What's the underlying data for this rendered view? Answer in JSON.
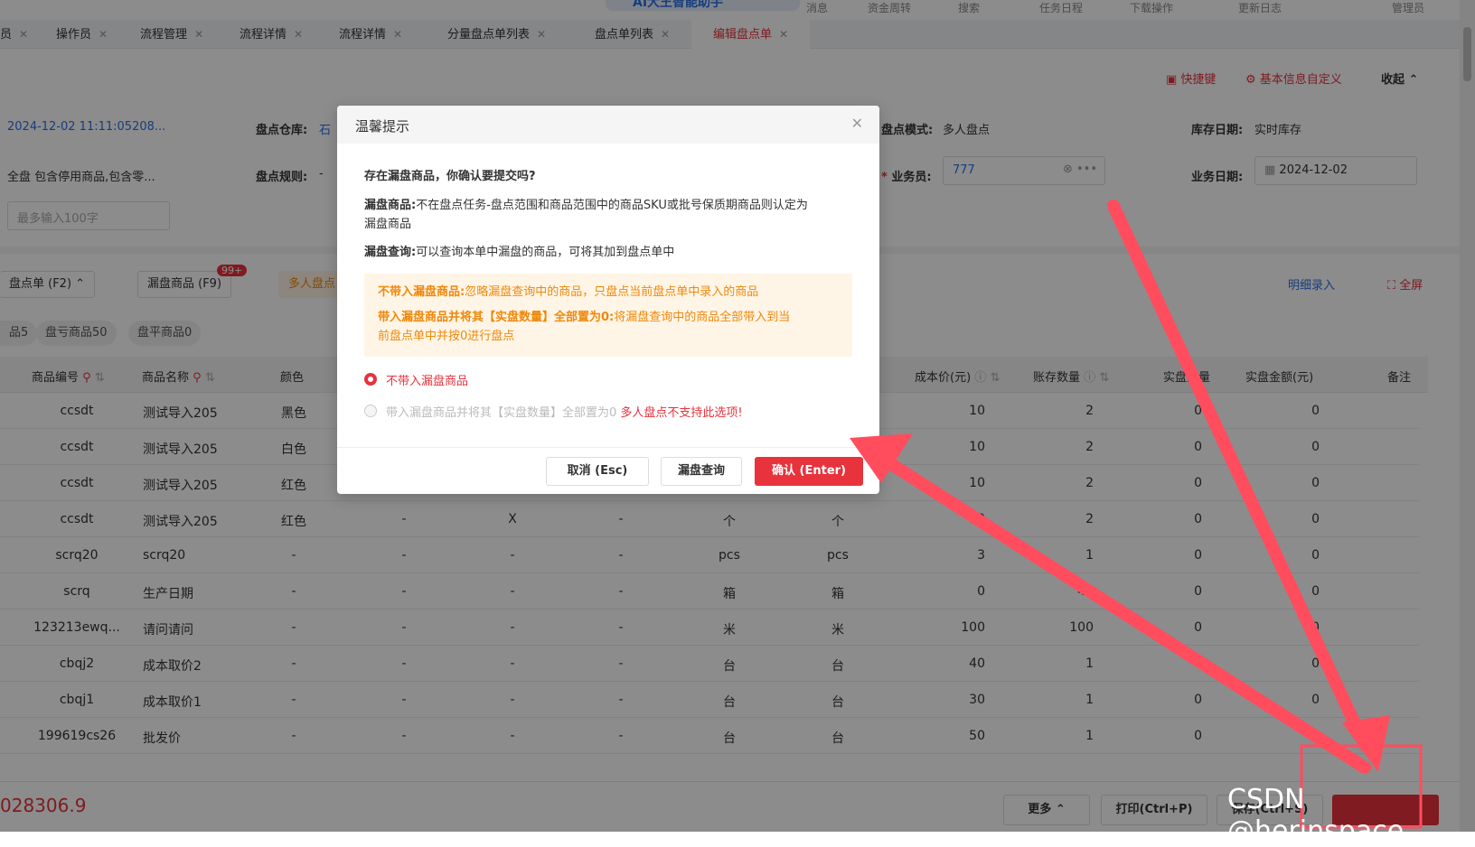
{
  "topbar": {
    "ai_label": "AI大王智能助手",
    "items": [
      "消息",
      "资金周转",
      "搜索",
      "任务日程",
      "下载操作",
      "更新日志",
      "管理员"
    ]
  },
  "tabs": [
    {
      "label": "员"
    },
    {
      "label": "操作员"
    },
    {
      "label": "流程管理"
    },
    {
      "label": "流程详情"
    },
    {
      "label": "流程详情"
    },
    {
      "label": "分量盘点单列表"
    },
    {
      "label": "盘点单列表"
    },
    {
      "label": "编辑盘点单"
    }
  ],
  "toolbar": {
    "shortcut": "快捷键",
    "custom": "基本信息自定义",
    "collapse": "收起"
  },
  "form": {
    "order_no": "2024-12-02 11:11:05208...",
    "warehouse_label": "盘点仓库:",
    "warehouse_value": "石",
    "mode_label": "盘点模式:",
    "mode_value": "多人盘点",
    "stock_date_label": "库存日期:",
    "stock_date_value": "实时库存",
    "scope_value": "全盘 包含停用商品,包含零...",
    "rule_label": "盘点规则:",
    "rule_value": "-",
    "salesman_label": "业务员:",
    "salesman_value": "777",
    "biz_date_label": "业务日期:",
    "biz_date_value": "2024-12-02",
    "remark_placeholder": "最多输入100字"
  },
  "actions": {
    "collapse_order": "盘点单 (F2)",
    "missed_goods": "漏盘商品 (F9)",
    "missed_badge": "99+",
    "multi": "多人盘点",
    "detail_entry": "明细录入",
    "fullscreen": "全屏"
  },
  "filters": [
    "品5",
    "盘亏商品50",
    "盘平商品0"
  ],
  "table": {
    "headers": [
      "商品编号",
      "商品名称",
      "颜色",
      "成本价(元)",
      "账存数量",
      "实盘数量",
      "实盘金额(元)",
      "备注"
    ],
    "rows": [
      {
        "code": "ccsdt",
        "name": "测试导入205",
        "color": "黑色",
        "cost": "10",
        "book": "2",
        "actual": "0",
        "amount": "0"
      },
      {
        "code": "ccsdt",
        "name": "测试导入205",
        "color": "白色",
        "cost": "10",
        "book": "2",
        "actual": "0",
        "amount": "0"
      },
      {
        "code": "ccsdt",
        "name": "测试导入205",
        "color": "红色",
        "cost": "10",
        "book": "2",
        "actual": "0",
        "amount": "0"
      },
      {
        "code": "ccsdt",
        "name": "测试导入205",
        "color": "红色",
        "c4": "-",
        "c5": "X",
        "c6": "-",
        "u1": "个",
        "u2": "个",
        "cost": "10",
        "book": "2",
        "actual": "0",
        "amount": "0"
      },
      {
        "code": "scrq20",
        "name": "scrq20",
        "color": "-",
        "c4": "-",
        "c5": "-",
        "c6": "-",
        "u1": "pcs",
        "u2": "pcs",
        "cost": "3",
        "book": "1",
        "actual": "0",
        "amount": "0"
      },
      {
        "code": "scrq",
        "name": "生产日期",
        "color": "-",
        "c4": "-",
        "c5": "-",
        "c6": "-",
        "u1": "箱",
        "u2": "箱",
        "cost": "0",
        "book": "40",
        "actual": "0",
        "amount": "0"
      },
      {
        "code": "123213ewq...",
        "name": "请问请问",
        "color": "-",
        "c4": "-",
        "c5": "-",
        "c6": "-",
        "u1": "米",
        "u2": "米",
        "cost": "100",
        "book": "100",
        "actual": "0",
        "amount": "0"
      },
      {
        "code": "cbqj2",
        "name": "成本取价2",
        "color": "-",
        "c4": "-",
        "c5": "-",
        "c6": "-",
        "u1": "台",
        "u2": "台",
        "cost": "40",
        "book": "1",
        "actual": "0",
        "amount": "0"
      },
      {
        "code": "cbqj1",
        "name": "成本取价1",
        "color": "-",
        "c4": "-",
        "c5": "-",
        "c6": "-",
        "u1": "台",
        "u2": "台",
        "cost": "30",
        "book": "1",
        "actual": "0",
        "amount": "0"
      },
      {
        "code": "199619cs26",
        "name": "批发价",
        "color": "-",
        "c4": "-",
        "c5": "-",
        "c6": "-",
        "u1": "台",
        "u2": "台",
        "cost": "50",
        "book": "1",
        "actual": "0",
        "amount": "0"
      }
    ]
  },
  "footer": {
    "total": "028306.9",
    "more": "更多",
    "print": "打印(Ctrl+P)",
    "save": "保存(Ctrl+S)"
  },
  "dialog": {
    "title": "温馨提示",
    "question": "存在漏盘商品，你确认要提交吗?",
    "def1_label": "漏盘商品:",
    "def1_text": "不在盘点任务-盘点范围和商品范围中的商品SKU或批号保质期商品则认定为",
    "def1_text2": "漏盘商品",
    "def2_label": "漏盘查询:",
    "def2_text": "可以查询本单中漏盘的商品，可将其加到盘点单中",
    "notice1_label": "不带入漏盘商品:",
    "notice1_text": "忽略漏盘查询中的商品，只盘点当前盘点单中录入的商品",
    "notice2_label": "带入漏盘商品并将其【实盘数量】全部置为0:",
    "notice2_text": "将漏盘查询中的商品全部带入到当",
    "notice2_text2": "前盘点单中并按0进行盘点",
    "option1": "不带入漏盘商品",
    "option2": "带入漏盘商品并将其【实盘数量】全部置为0",
    "option2_warn": "多人盘点不支持此选项!",
    "cancel": "取消 (Esc)",
    "query": "漏盘查询",
    "confirm": "确认 (Enter)"
  },
  "watermark": "CSDN @herinspace",
  "colors": {
    "accent": "#e8323c",
    "link": "#2b6fe6",
    "notice": "#f0880a",
    "annotation": "#ff4d5e"
  }
}
